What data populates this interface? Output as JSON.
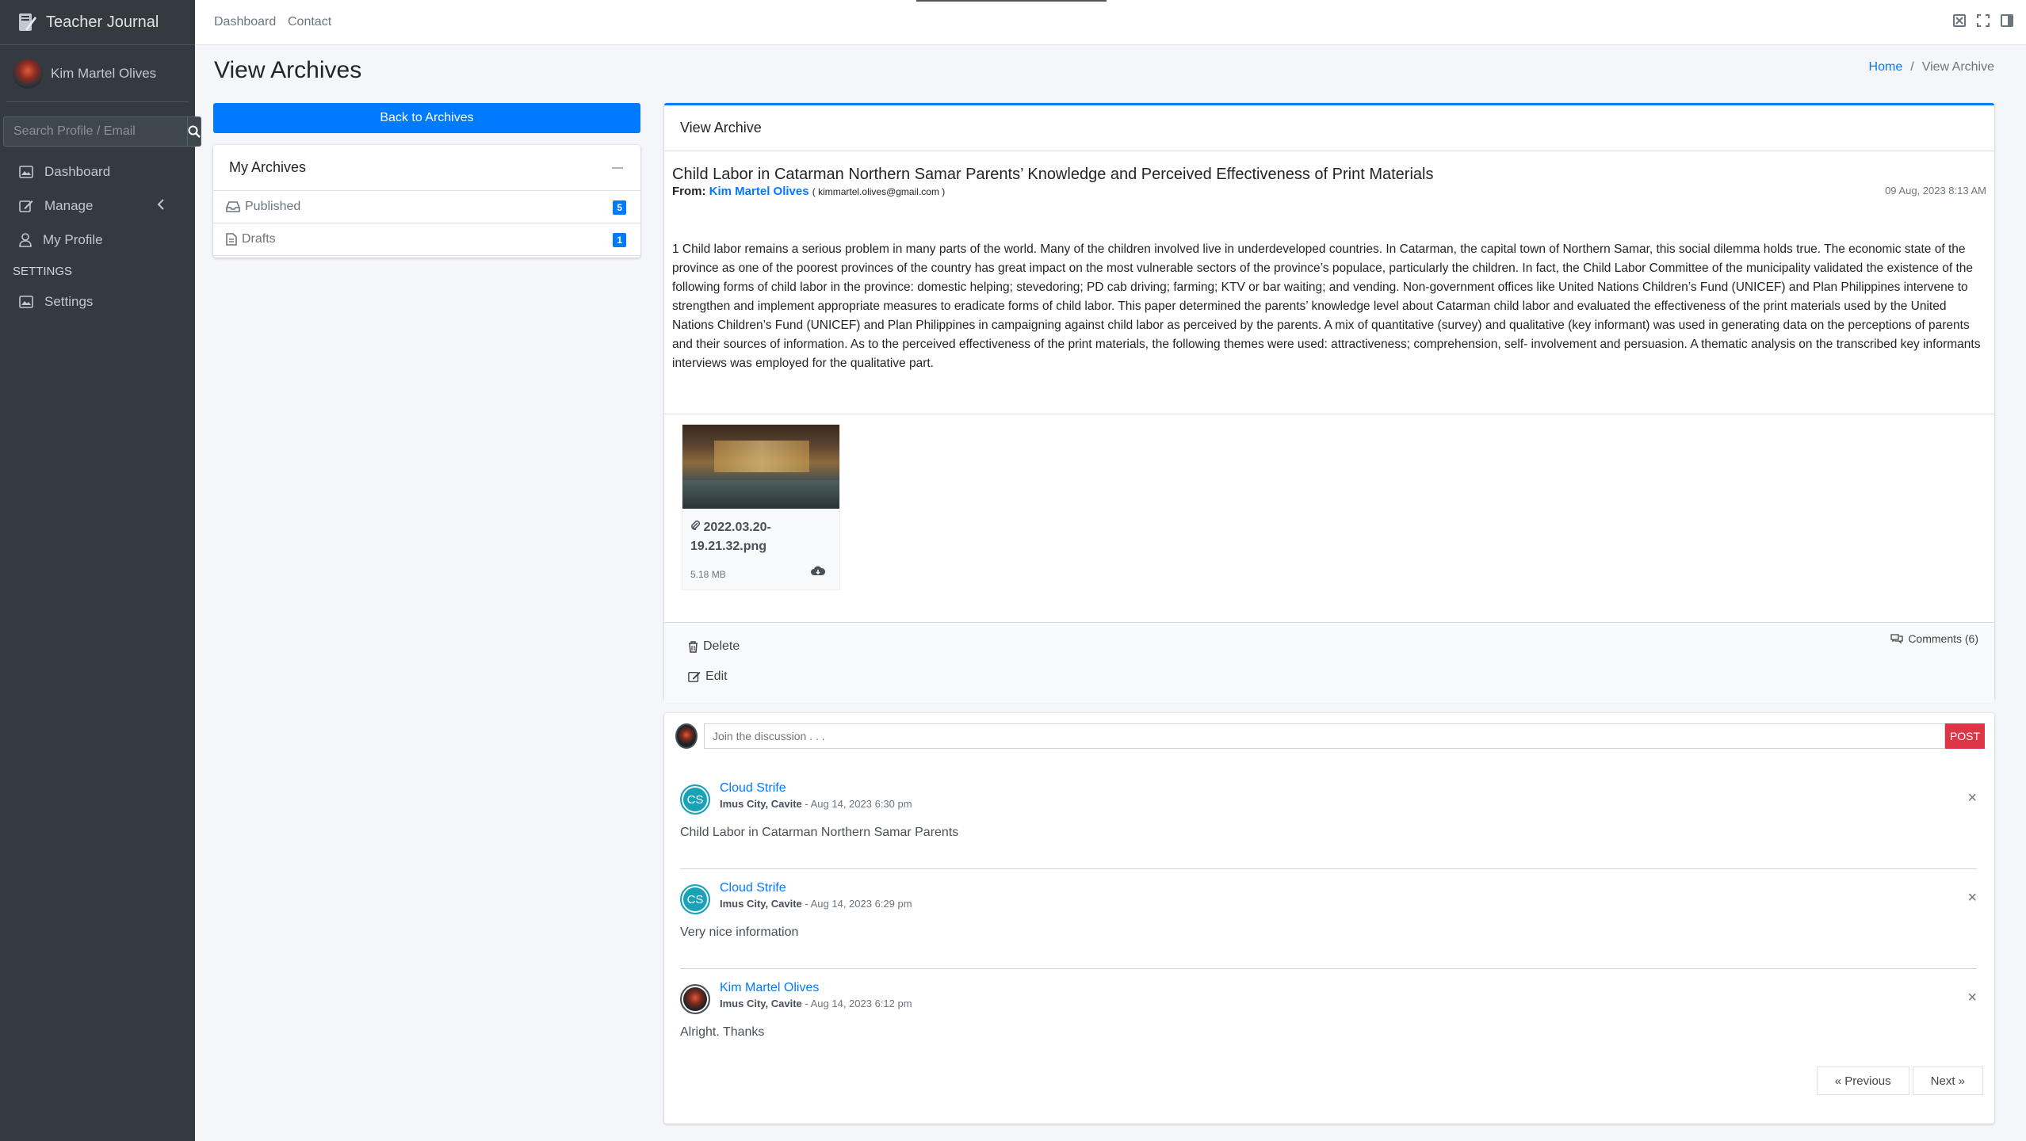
{
  "app": {
    "brand": "Teacher Journal"
  },
  "user": {
    "name": "Kim Martel Olives"
  },
  "sidebar": {
    "search_placeholder": "Search Profile / Email",
    "items": [
      {
        "label": "Dashboard",
        "icon": "dashboard-icon"
      },
      {
        "label": "Manage",
        "icon": "edit-icon"
      },
      {
        "label": "My Profile",
        "icon": "user-icon"
      }
    ],
    "settings_header": "SETTINGS",
    "settings_item": {
      "label": "Settings",
      "icon": "image-icon"
    }
  },
  "topnav": {
    "links": [
      "Dashboard",
      "Contact"
    ]
  },
  "page": {
    "title": "View Archives"
  },
  "breadcrumb": {
    "home": "Home",
    "current": "View Archive"
  },
  "archives": {
    "back_button": "Back to Archives",
    "card_title": "My Archives",
    "folders": [
      {
        "label": "Published",
        "count": "5"
      },
      {
        "label": "Drafts",
        "count": "1"
      }
    ]
  },
  "message": {
    "header": "View Archive",
    "subject": "Child Labor in Catarman Northern Samar Parents’ Knowledge and Perceived Effectiveness of Print Materials",
    "from_label": "From:",
    "sender": "Kim Martel Olives",
    "email": "( kimmartel.olives@gmail.com )",
    "date": "09 Aug, 2023 8:13 AM",
    "body": "1 Child labor remains a serious problem in many parts of the world. Many of the children involved live in underdeveloped countries. In Catarman, the capital town of Northern Samar, this social dilemma holds true. The economic state of the province as one of the poorest provinces of the country has great impact on the most vulnerable sectors of the province’s populace, particularly the children. In fact, the Child Labor Committee of the municipality validated the existence of the following forms of child labor in the province: domestic helping; stevedoring; PD cab driving; farming; KTV or bar waiting; and vending. Non-government offices like United Nations Children’s Fund (UNICEF) and Plan Philippines intervene to strengthen and implement appropriate measures to eradicate forms of child labor. This paper determined the parents’ knowledge level about Catarman child labor and evaluated the effectiveness of the print materials used by the United Nations Children’s Fund (UNICEF) and Plan Philippines in campaigning against child labor as perceived by the parents. A mix of quantitative (survey) and qualitative (key informant) was used in generating data on the perceptions of parents and their sources of information. As to the perceived effectiveness of the print materials, the following themes were used: attractiveness; comprehension, self- involvement and persuasion. A thematic analysis on the transcribed key informants interviews was employed for the qualitative part.",
    "attachment": {
      "name": "2022.03.20-19.21.32.png",
      "size": "5.18 MB"
    },
    "actions": {
      "delete": "Delete",
      "edit": "Edit",
      "comments": "Comments (6)"
    }
  },
  "discussion": {
    "placeholder": "Join the discussion . . .",
    "post_button": "POST",
    "comments": [
      {
        "initials": "CS",
        "name": "Cloud Strife",
        "location": "Imus City, Cavite",
        "time": " - Aug 14, 2023 6:30 pm",
        "text": "Child Labor in Catarman Northern Samar Parents"
      },
      {
        "initials": "CS",
        "name": "Cloud Strife",
        "location": "Imus City, Cavite",
        "time": " - Aug 14, 2023 6:29 pm",
        "text": "Very nice information"
      },
      {
        "initials": "",
        "name": "Kim Martel Olives",
        "location": "Imus City, Cavite",
        "time": " - Aug 14, 2023 6:12 pm",
        "text": "Alright. Thanks"
      }
    ],
    "close_glyph": "×",
    "pager": {
      "prev": "« Previous",
      "next": "Next »"
    }
  },
  "colors": {
    "primary": "#007bff",
    "sidebar_bg": "#343a40",
    "danger": "#dc3545",
    "info": "#17a2b8"
  }
}
